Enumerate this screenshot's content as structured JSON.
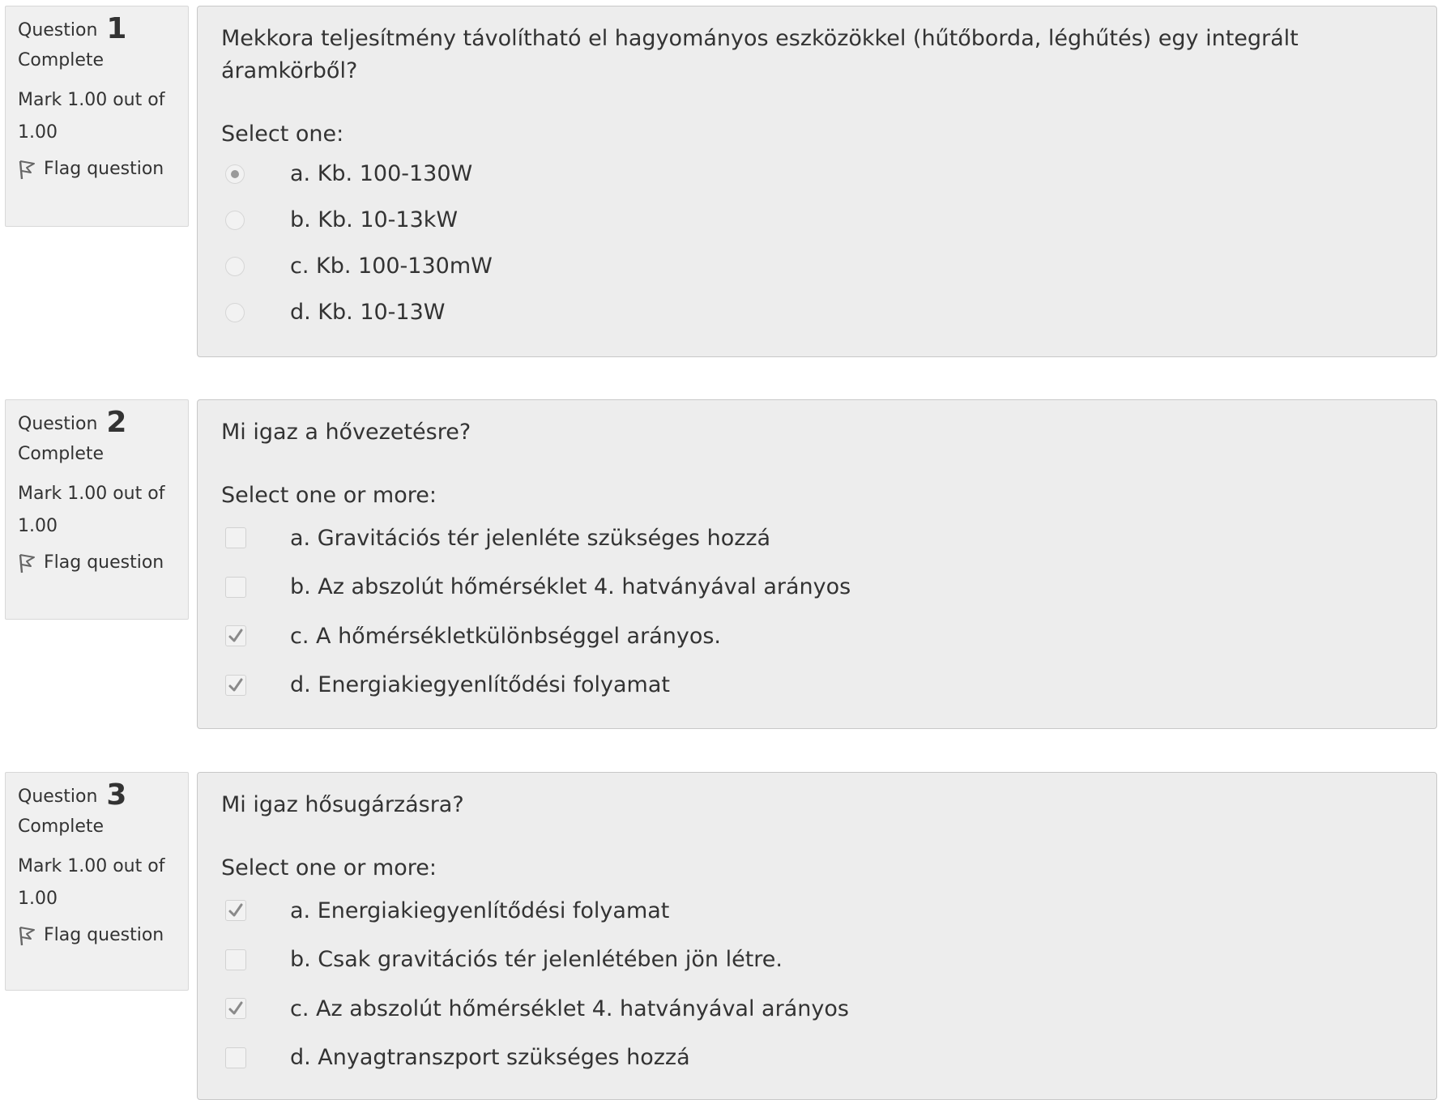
{
  "questions": [
    {
      "label": "Question",
      "number": "1",
      "state": "Complete",
      "grade": "Mark 1.00 out of 1.00",
      "flag_label": "Flag question",
      "text": "Mekkora teljesítmény távolítható el hagyományos eszközökkel (hűtőborda, léghűtés) egy integrált áramkörből?",
      "prompt": "Select one:",
      "type": "radio",
      "answers": [
        {
          "label": "a. Kb. 100-130W",
          "selected": true
        },
        {
          "label": "b. Kb. 10-13kW",
          "selected": false
        },
        {
          "label": "c. Kb. 100-130mW",
          "selected": false
        },
        {
          "label": "d. Kb. 10-13W",
          "selected": false
        }
      ]
    },
    {
      "label": "Question",
      "number": "2",
      "state": "Complete",
      "grade": "Mark 1.00 out of 1.00",
      "flag_label": "Flag question",
      "text": "Mi igaz a hővezetésre?",
      "prompt": "Select one or more:",
      "type": "checkbox",
      "answers": [
        {
          "label": "a. Gravitációs tér jelenléte szükséges hozzá",
          "selected": false
        },
        {
          "label": "b. Az abszolút hőmérséklet 4. hatványával arányos",
          "selected": false
        },
        {
          "label": "c. A hőmérsékletkülönbséggel arányos.",
          "selected": true
        },
        {
          "label": "d. Energiakiegyenlítődési folyamat",
          "selected": true
        }
      ]
    },
    {
      "label": "Question",
      "number": "3",
      "state": "Complete",
      "grade": "Mark 1.00 out of 1.00",
      "flag_label": "Flag question",
      "text": "Mi igaz hősugárzásra?",
      "prompt": "Select one or more:",
      "type": "checkbox",
      "answers": [
        {
          "label": "a. Energiakiegyenlítődési folyamat",
          "selected": true
        },
        {
          "label": "b. Csak gravitációs tér jelenlétében jön létre.",
          "selected": false
        },
        {
          "label": "c. Az abszolút hőmérséklet 4. hatványával arányos",
          "selected": true
        },
        {
          "label": "d. Anyagtranszport szükséges hozzá",
          "selected": false
        }
      ]
    }
  ],
  "colors": {
    "info_bg": "#f0f0f0",
    "content_bg": "#ededed",
    "text": "#333333",
    "control_mark": "#9a9a9a"
  }
}
